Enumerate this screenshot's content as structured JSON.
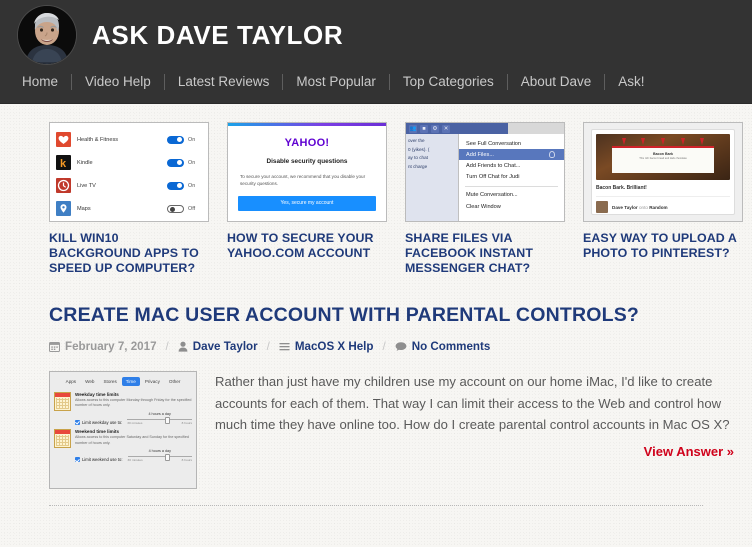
{
  "header": {
    "site_title": "ASK DAVE TAYLOR",
    "avatar_name": "dave-taylor-avatar",
    "nav": [
      {
        "label": "Home"
      },
      {
        "label": "Video Help"
      },
      {
        "label": "Latest Reviews"
      },
      {
        "label": "Most Popular"
      },
      {
        "label": "Top Categories"
      },
      {
        "label": "About Dave"
      },
      {
        "label": "Ask!"
      }
    ]
  },
  "colors": {
    "header_bg": "#333333",
    "page_bg": "#f7f6f3",
    "heading_blue": "#1f3a7a",
    "link_red": "#d0021b",
    "meta_gray": "#9a9a9a",
    "body_gray": "#5a5a5a"
  },
  "cards": [
    {
      "title": "KILL WIN10 BACKGROUND APPS TO SPEED UP COMPUTER?",
      "thumb_type": "win10-background-apps",
      "rows": [
        {
          "app": "Health & Fitness",
          "state": "On",
          "icon": "heart-icon"
        },
        {
          "app": "Kindle",
          "state": "On",
          "icon": "kindle-icon"
        },
        {
          "app": "Live TV",
          "state": "On",
          "icon": "live-tv-icon"
        },
        {
          "app": "Maps",
          "state": "Off",
          "icon": "maps-icon"
        }
      ]
    },
    {
      "title": "HOW TO SECURE YOUR YAHOO.COM ACCOUNT",
      "thumb_type": "yahoo-security-dialog",
      "logo": "YAHOO!",
      "heading": "Disable security questions",
      "paragraph": "To secure your account, we recommend that you disable your security questions.",
      "button": "Yes, secure my account"
    },
    {
      "title": "SHARE FILES VIA FACEBOOK INSTANT MESSENGER CHAT?",
      "thumb_type": "facebook-chat-menu",
      "chat_snippet": [
        "over the",
        "0 (yikes). (",
        "ay to chat",
        "nt charge"
      ],
      "menu": [
        {
          "label": "See Full Conversation",
          "selected": false
        },
        {
          "label": "Add Files...",
          "selected": true
        },
        {
          "label": "Add Friends to Chat...",
          "selected": false
        },
        {
          "label": "Turn Off Chat for Judi",
          "selected": false
        },
        {
          "label": "Mute Conversation...",
          "selected": false
        },
        {
          "label": "Clear Window",
          "selected": false
        }
      ],
      "titlebar_icons": [
        "people-icon",
        "window-icon",
        "gear-icon",
        "close-icon"
      ]
    },
    {
      "title": "EASY WAY TO UPLOAD A PHOTO TO PINTEREST?",
      "thumb_type": "pinterest-pin",
      "pin_caption": "Bacon Bark. Brilliant!",
      "pin_label_title": "Bacon Bark",
      "pin_label_text": "This rich bacon bread and dark chocolate",
      "pin_user": "Dave Taylor",
      "pin_onto": "onto",
      "pin_board": "Random"
    }
  ],
  "article": {
    "title": "CREATE MAC USER ACCOUNT WITH PARENTAL CONTROLS?",
    "meta": {
      "date": "February 7, 2017",
      "author": "Dave Taylor",
      "category": "MacOS X Help",
      "comments": "No Comments",
      "separator": "/"
    },
    "body": "Rather than just have my children use my account on our home iMac, I'd like to create accounts for each of them. That way I can limit their access to the Web and control how much time they have online too. How do I create parental control accounts in Mac OS X?",
    "view_answer": "View Answer »",
    "thumb": {
      "type": "macos-parental-controls",
      "tabs": [
        {
          "label": "Apps",
          "active": false
        },
        {
          "label": "Web",
          "active": false
        },
        {
          "label": "Stores",
          "active": false
        },
        {
          "label": "Time",
          "active": true
        },
        {
          "label": "Privacy",
          "active": false
        },
        {
          "label": "Other",
          "active": false
        }
      ],
      "sections": [
        {
          "heading": "Weekday time limits",
          "description": "Allows access to this computer Monday through Friday for the specified number of hours only.",
          "checkbox_label": "Limit weekday use to:",
          "checked": true,
          "slider_value": "4 hours a day",
          "tick_min": "30 minutes",
          "tick_max": "8 hours"
        },
        {
          "heading": "Weekend time limits",
          "description": "Allows access to this computer Saturday and Sunday for the specified number of hours only.",
          "checkbox_label": "Limit weekend use to:",
          "checked": true,
          "slider_value": "4 hours a day",
          "tick_min": "30 minutes",
          "tick_max": "8 hours"
        }
      ]
    }
  }
}
